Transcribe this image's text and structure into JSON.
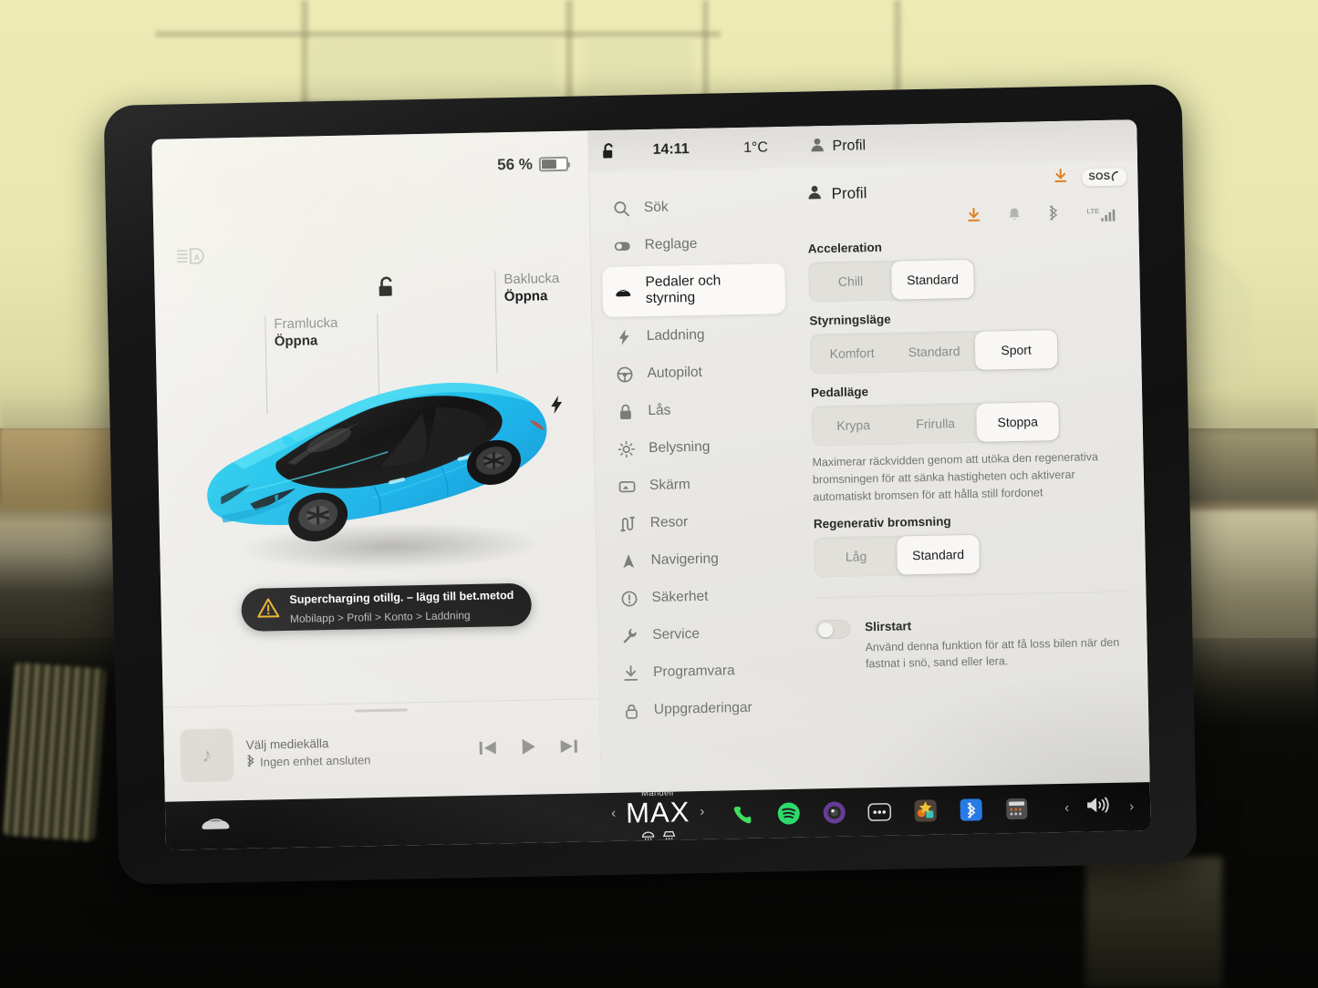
{
  "car_panel": {
    "battery_percent": "56 %",
    "battery_level": 56,
    "auto_headlight_icon": "auto-headlight-icon",
    "front_trunk": {
      "label": "Framlucka",
      "action": "Öppna"
    },
    "rear_trunk": {
      "label": "Baklucka",
      "action": "Öppna"
    },
    "unlock_icon": "unlock-icon",
    "charge_port_icon": "charge-bolt-icon",
    "car_color": "#28c8ef",
    "roof_color": "#1b1b1b",
    "notification": {
      "title": "Supercharging otillg. – lägg till bet.metod",
      "subtitle": "Mobilapp > Profil > Konto > Laddning",
      "icon": "warning-triangle-icon",
      "icon_color": "#e8b228"
    },
    "media": {
      "title": "Välj mediekälla",
      "subtitle": "Ingen enhet ansluten",
      "bluetooth_icon": "bluetooth-icon",
      "art_icon": "music-note-icon",
      "controls": [
        "skip-previous-icon",
        "play-icon",
        "skip-next-icon"
      ]
    }
  },
  "status_strip": {
    "lock_icon": "unlocked-padlock-icon",
    "clock": "14:11",
    "temperature": "1°C",
    "profile_icon": "person-icon",
    "profile_name": "Profil"
  },
  "top_right": {
    "download_icon": "software-download-icon",
    "download_color": "#e08021",
    "sos_label": "SOS"
  },
  "sidebar": {
    "items": [
      {
        "label": "Sök",
        "icon": "search-icon",
        "active": false
      },
      {
        "label": "Reglage",
        "icon": "toggle-icon",
        "active": false
      },
      {
        "label": "Pedaler och styrning",
        "icon": "car-front-icon",
        "active": true
      },
      {
        "label": "Laddning",
        "icon": "bolt-icon",
        "active": false
      },
      {
        "label": "Autopilot",
        "icon": "steering-wheel-icon",
        "active": false
      },
      {
        "label": "Lås",
        "icon": "padlock-icon",
        "active": false
      },
      {
        "label": "Belysning",
        "icon": "sun-brightness-icon",
        "active": false
      },
      {
        "label": "Skärm",
        "icon": "display-icon",
        "active": false
      },
      {
        "label": "Resor",
        "icon": "trips-icon",
        "active": false
      },
      {
        "label": "Navigering",
        "icon": "navigation-arrow-icon",
        "active": false
      },
      {
        "label": "Säkerhet",
        "icon": "exclamation-circle-icon",
        "active": false
      },
      {
        "label": "Service",
        "icon": "wrench-icon",
        "active": false
      },
      {
        "label": "Programvara",
        "icon": "download-icon",
        "active": false
      },
      {
        "label": "Uppgraderingar",
        "icon": "upgrade-lock-icon",
        "active": false
      }
    ]
  },
  "content": {
    "header": {
      "icon": "person-icon",
      "title": "Profil"
    },
    "status_icons": [
      "software-download-icon",
      "bell-icon",
      "bluetooth-icon",
      "lte-signal-icon"
    ],
    "lte_label": "LTE",
    "sections": [
      {
        "label": "Acceleration",
        "options": [
          {
            "text": "Chill",
            "selected": false
          },
          {
            "text": "Standard",
            "selected": true
          }
        ]
      },
      {
        "label": "Styrningsläge",
        "options": [
          {
            "text": "Komfort",
            "selected": false
          },
          {
            "text": "Standard",
            "selected": false
          },
          {
            "text": "Sport",
            "selected": true
          }
        ]
      },
      {
        "label": "Pedalläge",
        "options": [
          {
            "text": "Krypa",
            "selected": false
          },
          {
            "text": "Frirulla",
            "selected": false
          },
          {
            "text": "Stoppa",
            "selected": true
          }
        ],
        "help": "Maximerar räckvidden genom att utöka den regenerativa bromsningen för att sänka hastigheten och aktiverar automatiskt bromsen för att hålla still fordonet"
      },
      {
        "label": "Regenerativ bromsning",
        "options": [
          {
            "text": "Låg",
            "selected": false
          },
          {
            "text": "Standard",
            "selected": true
          }
        ]
      }
    ],
    "toggle": {
      "title": "Slirstart",
      "description": "Använd denna funktion för att få loss bilen när den fastnat i snö, sand eller lera.",
      "state": "off"
    }
  },
  "taskbar": {
    "car_icon": "car-icon",
    "climate": {
      "mode": "Manuell",
      "temperature": "MAX",
      "left_chevron": "chevron-left-icon",
      "right_chevron": "chevron-right-icon",
      "defrost_icons": [
        "rear-defrost-icon",
        "front-defrost-icon"
      ]
    },
    "apps": [
      {
        "name": "phone-app-icon",
        "color": "#2fdc52"
      },
      {
        "name": "spotify-app-icon",
        "color": "#1ed760"
      },
      {
        "name": "dashcam-app-icon",
        "color": "#6b3fa0"
      },
      {
        "name": "more-apps-icon",
        "color": "#e8e8e8"
      },
      {
        "name": "toybox-app-icon",
        "color": "#f0a030"
      },
      {
        "name": "bluetooth-app-icon",
        "color": "#1f7bf0"
      },
      {
        "name": "theater-app-icon",
        "color": "#8a8a8a"
      }
    ],
    "volume": {
      "icon": "volume-icon",
      "left_chevron": "chevron-left-icon",
      "right_chevron": "chevron-right-icon"
    }
  }
}
